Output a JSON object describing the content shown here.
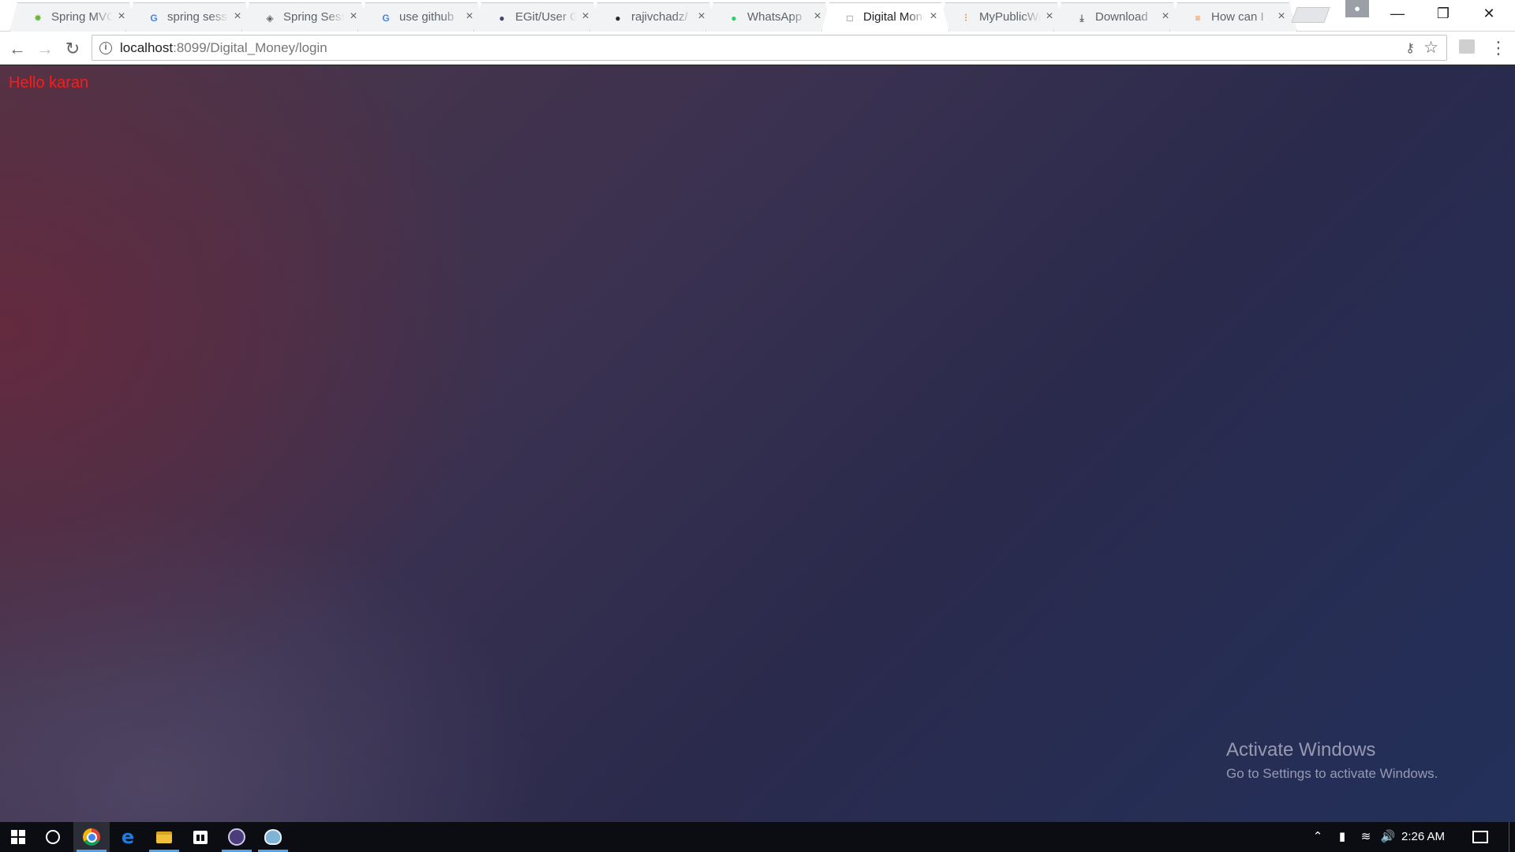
{
  "browser": {
    "tabs": [
      {
        "title": "Spring MVC",
        "favicon": "spring-icon",
        "fav_color": "#6db33f",
        "active": false
      },
      {
        "title": "spring session",
        "favicon": "google-icon",
        "fav_color": "#4285f4",
        "active": false
      },
      {
        "title": "Spring Session",
        "favicon": "spring-session-icon",
        "fav_color": "#5f6368",
        "active": false
      },
      {
        "title": "use github",
        "favicon": "google-icon",
        "fav_color": "#4285f4",
        "active": false
      },
      {
        "title": "EGit/User Guide",
        "favicon": "eclipse-icon",
        "fav_color": "#4b3c7a",
        "active": false
      },
      {
        "title": "rajivchadz/",
        "favicon": "github-icon",
        "fav_color": "#24292e",
        "active": false
      },
      {
        "title": "WhatsApp",
        "favicon": "whatsapp-icon",
        "fav_color": "#25d366",
        "active": false
      },
      {
        "title": "Digital Money",
        "favicon": "page-icon",
        "fav_color": "#5f6368",
        "active": true
      },
      {
        "title": "MyPublicWiFi",
        "favicon": "wifi-icon",
        "fav_color": "#d98b3a",
        "active": false
      },
      {
        "title": "Download",
        "favicon": "download-icon",
        "fav_color": "#5f6368",
        "active": false
      },
      {
        "title": "How can I",
        "favicon": "stackoverflow-icon",
        "fav_color": "#f48024",
        "active": false
      }
    ],
    "address": {
      "host": "localhost",
      "path": ":8099/Digital_Money/login"
    }
  },
  "page": {
    "greeting": "Hello karan",
    "greeting_color": "#ff1a1a"
  },
  "watermark": {
    "heading": "Activate Windows",
    "subtext": "Go to Settings to activate Windows."
  },
  "taskbar": {
    "apps": [
      {
        "name": "chrome",
        "running": true,
        "current": true
      },
      {
        "name": "edge",
        "running": false
      },
      {
        "name": "file-explorer",
        "running": true
      },
      {
        "name": "store",
        "running": false
      },
      {
        "name": "eclipse",
        "running": true
      },
      {
        "name": "app",
        "running": true
      }
    ],
    "clock": "2:26 AM"
  }
}
